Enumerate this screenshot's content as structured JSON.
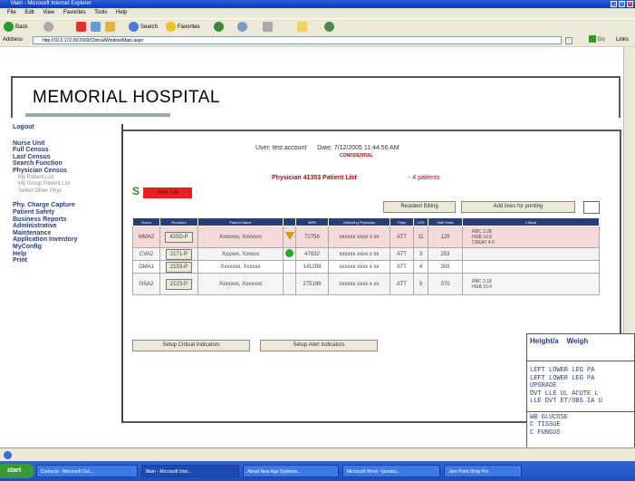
{
  "window": {
    "title": "Main - Microsoft Internet Explorer"
  },
  "menu": [
    "File",
    "Edit",
    "View",
    "Favorites",
    "Tools",
    "Help"
  ],
  "toolbar": {
    "back": "Back",
    "search": "Search",
    "favorites": "Favorites"
  },
  "address": {
    "label": "Address",
    "url": "http://10.0.172.99:2003/ClinicalWindow/Main.aspx",
    "go": "Go",
    "links": "Links"
  },
  "hospital": "MEMORIAL HOSPITAL",
  "sidebar": {
    "items": [
      "Logout",
      "Nurse Unit",
      "Full Census",
      "Last Census",
      "Search Function",
      "Physician Census"
    ],
    "sub": [
      "My Patient List",
      "My Group Patient List",
      "Select Other Phys"
    ],
    "items2": [
      "Phy. Charge Capture",
      "Patient Safety",
      "Business Reports",
      "Administrative",
      "Maintenance",
      "Application Inventory",
      "MyConfig",
      "Help",
      "Print"
    ]
  },
  "header": {
    "user": "User: test account",
    "date": "Date: 7/12/2005 11:44:56 AM",
    "confidential": "CONFIDENTIAL",
    "physician": "Physician 41353 Patient List",
    "count": "- 4 patients"
  },
  "badge": {
    "s": "S",
    "label": "Alert List"
  },
  "buttons": {
    "resident": "Resident Billing",
    "addlines": "Add lines for printing",
    "setup_critical": "Setup Critical Indicators",
    "setup_alert": "Setup Alert Indicators"
  },
  "table": {
    "headers": [
      "Room",
      "Rounded",
      "Patient Name",
      "",
      "MRN",
      "Attending Physician",
      "Phys",
      "LOS",
      "Visit Order",
      "Critical"
    ],
    "rows": [
      {
        "room": "MMA2",
        "rounded": "420D-P",
        "name": "Xxxxxxx, Xxxxxxx",
        "mrn": "72756",
        "att": "xxxxxx xxxx x xx",
        "phys": "ATT",
        "los": "11",
        "visit": "129",
        "critical": [
          "RBC 3.28",
          "HGB 10.8",
          "CREAT 4.0"
        ],
        "flag": "tri"
      },
      {
        "room": "CVA2",
        "rounded": "2171-P",
        "name": "Xxxxxx, Xxxxxx",
        "mrn": "47832",
        "att": "xxxxxx xxxx x xx",
        "phys": "ATT",
        "los": "3",
        "visit": "253",
        "critical": [],
        "flag": "dot"
      },
      {
        "room": "OMA1",
        "rounded": "2153-P",
        "name": "Xxxxxxx, Xxxxxx",
        "mrn": "141208",
        "att": "xxxxxx xxxx x xx",
        "phys": "ATT",
        "los": "4",
        "visit": "309",
        "critical": [],
        "flag": ""
      },
      {
        "room": "GSA2",
        "rounded": "2123-P",
        "name": "Xxxxxxx, Xxxxxxx",
        "mrn": "275199",
        "att": "xxxxxx xxxx x xx",
        "phys": "ATT",
        "los": "9",
        "visit": "370",
        "critical": [
          "RBC 3.18",
          "HGB 10.4"
        ],
        "flag": ""
      }
    ]
  },
  "popup": {
    "h1": "Height/a",
    "h2": "Weigh",
    "lines": [
      "LEFT LOWER LEG PA",
      "LEFT LOWER LEG PA",
      "UPGRADE",
      "DVT LLE UL ACUTE L",
      "LLE DVT ET/OBS IA U"
    ],
    "lines2": [
      "WB GLUCOSE",
      "C TISSUE",
      "C FUNGUS"
    ]
  },
  "taskbar": {
    "start": "start",
    "tasks": [
      "Contacts - Microsoft Out...",
      "Main - Microsoft Inter...",
      "About New Age Systems...",
      "Microsoft Word - Ipresbu...",
      "Jam Point Shop Pro"
    ]
  }
}
